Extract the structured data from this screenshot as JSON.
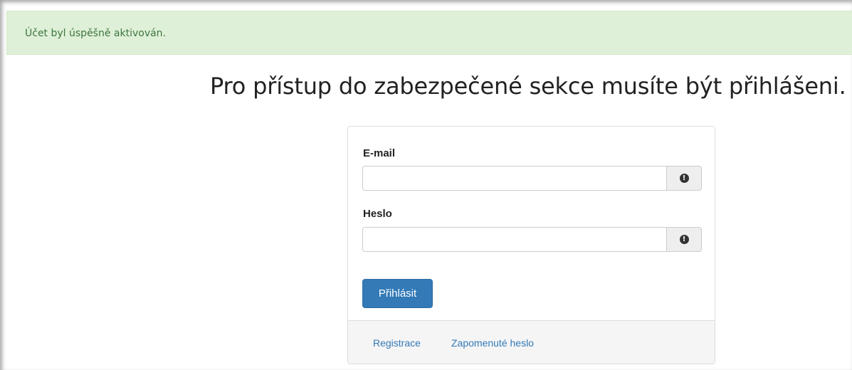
{
  "alert": {
    "message": "Účet byl úspěšně aktivován."
  },
  "page": {
    "heading": "Pro přístup do zabezpečené sekce musíte být přihlášeni."
  },
  "login_form": {
    "email_label": "E-mail",
    "email_value": "",
    "email_placeholder": "",
    "password_label": "Heslo",
    "password_value": "",
    "password_placeholder": "",
    "submit_label": "Přihlásit",
    "addon_icon": "exclamation-circle-icon",
    "addon_glyph": "!"
  },
  "footer": {
    "register_link": "Registrace",
    "forgot_link": "Zapomenuté heslo"
  },
  "colors": {
    "alert_bg": "#dff0d8",
    "alert_text": "#3c763d",
    "primary": "#337ab7"
  }
}
